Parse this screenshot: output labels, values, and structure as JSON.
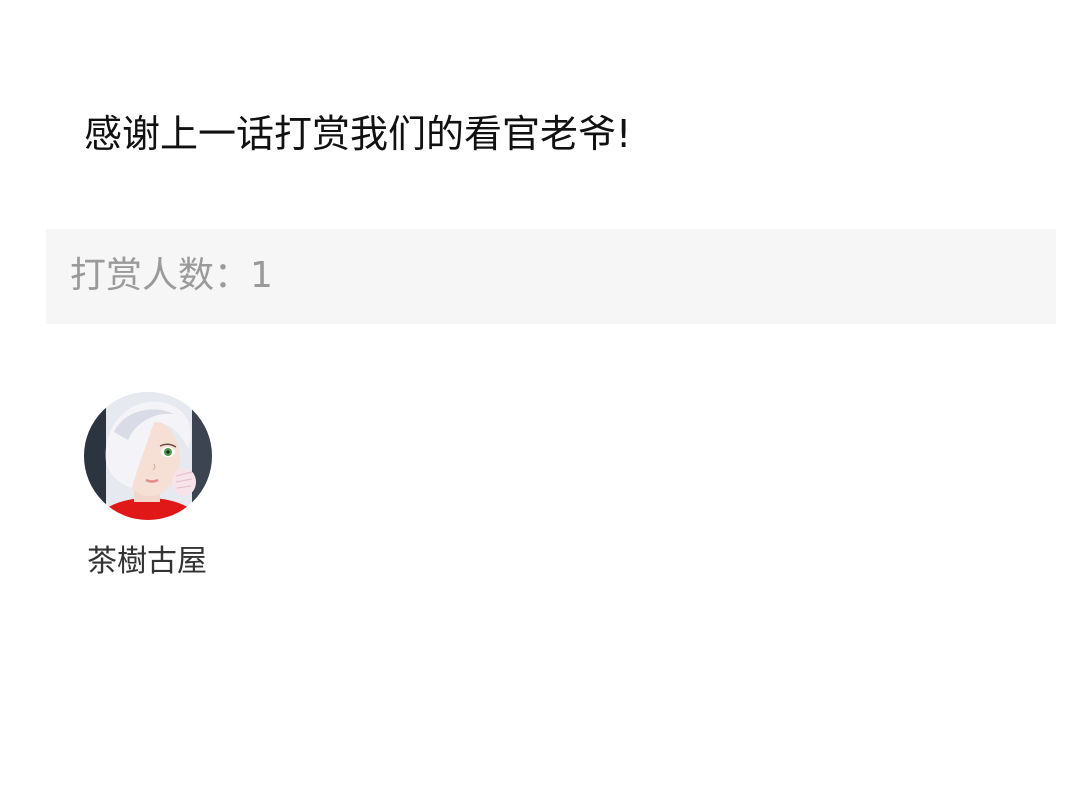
{
  "header": {
    "thanks_text": "感谢上一话打赏我们的看官老爷!"
  },
  "tip_summary": {
    "label": "打赏人数：",
    "count": "1"
  },
  "supporters": [
    {
      "name": "茶樹古屋",
      "avatar": "anime-character-avatar"
    }
  ]
}
